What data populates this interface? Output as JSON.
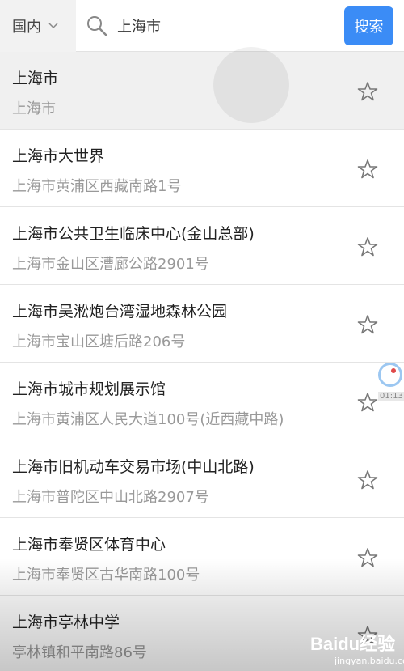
{
  "topbar": {
    "region_label": "国内",
    "search_value": "上海市",
    "search_button": "搜索"
  },
  "results": [
    {
      "title": "上海市",
      "address": "上海市"
    },
    {
      "title": "上海市大世界",
      "address": "上海市黄浦区西藏南路1号"
    },
    {
      "title": "上海市公共卫生临床中心(金山总部)",
      "address": "上海市金山区漕廊公路2901号"
    },
    {
      "title": "上海市吴淞炮台湾湿地森林公园",
      "address": "上海市宝山区塘后路206号"
    },
    {
      "title": "上海市城市规划展示馆",
      "address": "上海市黄浦区人民大道100号(近西藏中路)"
    },
    {
      "title": "上海市旧机动车交易市场(中山北路)",
      "address": "上海市普陀区中山北路2907号"
    },
    {
      "title": "上海市奉贤区体育中心",
      "address": "上海市奉贤区古华南路100号"
    },
    {
      "title": "上海市亭林中学",
      "address": "亭林镇和平南路86号"
    }
  ],
  "recorder": {
    "time": "01:13"
  },
  "watermark": {
    "brand": "Baidu经验",
    "url": "jingyan.baidu.com"
  },
  "colors": {
    "accent": "#3b8cf6",
    "secondary_text": "#999999"
  }
}
